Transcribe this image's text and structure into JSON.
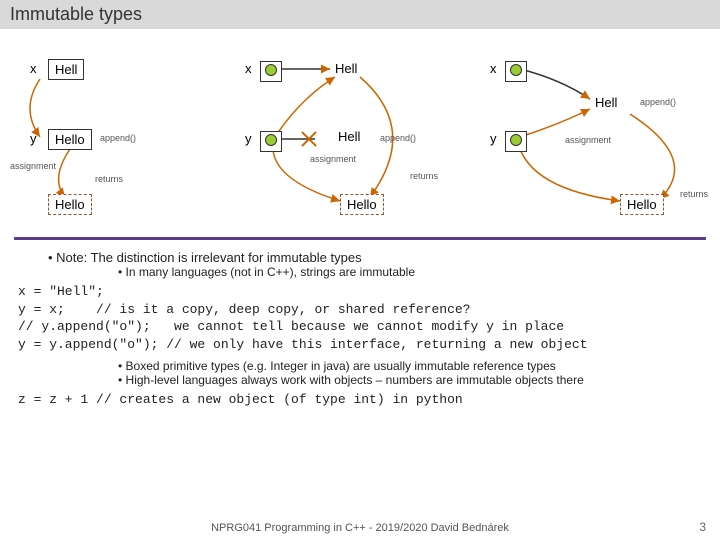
{
  "title": "Immutable types",
  "labels": {
    "x": "x",
    "y": "y",
    "Hell": "Hell",
    "Hello": "Hello",
    "append": "append()",
    "assignment": "assignment",
    "returns": "returns"
  },
  "notes": {
    "line1": "Note: The distinction is irrelevant for immutable types",
    "line2": "In many languages (not in C++), strings are immutable",
    "line3": "Boxed primitive types (e.g. Integer in java) are usually immutable reference types",
    "line4": "High-level languages always work with objects – numbers are immutable objects there"
  },
  "code1": "x = \"Hell\";\ny = x;    // is it a copy, deep copy, or shared reference?\n// y.append(\"o\");   we cannot tell because we cannot modify y in place\ny = y.append(\"o\"); // we only have this interface, returning a new object",
  "code2": "z = z + 1 // creates a new object (of type int) in python",
  "footer": "NPRG041 Programming in C++ - 2019/2020 David Bednárek",
  "page": "3"
}
